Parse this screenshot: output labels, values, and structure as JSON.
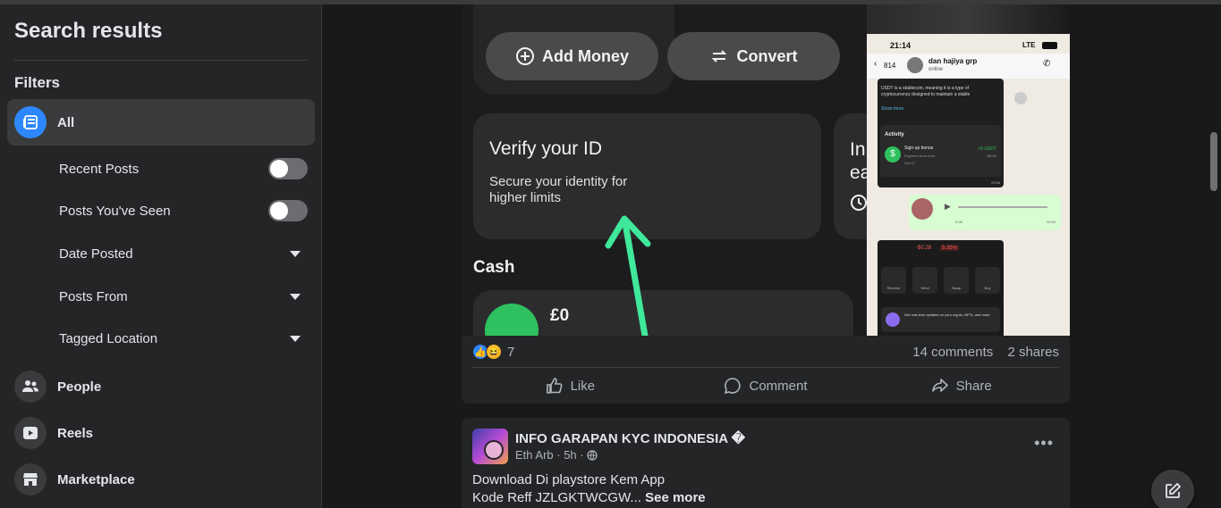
{
  "sidebar": {
    "title": "Search results",
    "filters_heading": "Filters",
    "all_label": "All",
    "filters": [
      {
        "label": "Recent Posts",
        "control": "toggle",
        "on": false
      },
      {
        "label": "Posts You've Seen",
        "control": "toggle",
        "on": false
      },
      {
        "label": "Date Posted",
        "control": "dropdown"
      },
      {
        "label": "Posts From",
        "control": "dropdown"
      },
      {
        "label": "Tagged Location",
        "control": "dropdown"
      }
    ],
    "nav": [
      {
        "label": "People",
        "icon": "people-icon"
      },
      {
        "label": "Reels",
        "icon": "reels-icon"
      },
      {
        "label": "Marketplace",
        "icon": "marketplace-icon"
      }
    ]
  },
  "post1": {
    "image_left": {
      "add_money": "Add Money",
      "convert": "Convert",
      "verify_title": "Verify your ID",
      "verify_sub": "Secure your identity for higher limits",
      "side_text": "In ea",
      "cash_label": "Cash",
      "cash_amount": "£0"
    },
    "image_right": {
      "time": "21:14",
      "signal": "LTE",
      "back_count": "814",
      "contact_name": "dan hajiya grp",
      "contact_status": "online",
      "msg1": "USDT is a stablecoin, meaning it is a type of cryptocurrency designed to maintain a stable",
      "show_more": "Show more",
      "activity_title": "Activity",
      "signup_bonus": "Sign-up bonus",
      "payment_from": "Payment from Kem",
      "date": "Oct 07",
      "bonus_amount": "+5 USDT",
      "bonus_usd": "+$5.00",
      "msg_time1": "20:56",
      "voice_start": "0:08",
      "voice_time": "20:56",
      "balance_change": "-$0.28",
      "balance_pct": "5.35%",
      "actions": [
        "Receive",
        "Send",
        "Swap",
        "Buy"
      ],
      "updates_text": "Get real-time updates on your crypto, NFTs, and more"
    },
    "reaction_count": "7",
    "comments": "14 comments",
    "shares": "2 shares",
    "actions": {
      "like": "Like",
      "comment": "Comment",
      "share": "Share"
    }
  },
  "post2": {
    "author": "INFO GARAPAN KYC INDONESIA �",
    "sub_author": "Eth Arb",
    "time": "5h",
    "line1": "Download Di playstore Kem App",
    "line2": "Kode Reff JZLGKTWCGW...",
    "see_more": "See more"
  },
  "colors": {
    "bg": "#18191a",
    "card": "#242526",
    "accent": "#2d88ff",
    "green": "#2fc15f"
  }
}
